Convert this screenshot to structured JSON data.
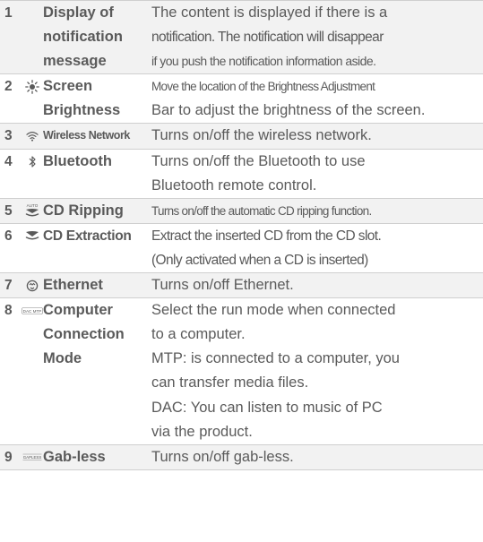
{
  "rows": [
    {
      "num": "1",
      "icon": "none",
      "name": [
        "Display of",
        "notification",
        "message"
      ],
      "desc": [
        "The content is displayed if there is a",
        "notification. The notification will disappear",
        "if you push the notification information aside."
      ]
    },
    {
      "num": "2",
      "icon": "sun-icon",
      "name": [
        "Screen",
        "Brightness"
      ],
      "desc": [
        "Move the location of the Brightness Adjustment",
        "Bar to adjust the brightness of the screen."
      ]
    },
    {
      "num": "3",
      "icon": "wifi-icon",
      "name": [
        "Wireless Network"
      ],
      "desc": [
        "Turns on/off the wireless network."
      ]
    },
    {
      "num": "4",
      "icon": "bluetooth-icon",
      "name": [
        "Bluetooth"
      ],
      "desc": [
        "Turns on/off the Bluetooth to use",
        "Bluetooth remote control."
      ]
    },
    {
      "num": "5",
      "icon": "cd-ripping-icon",
      "icon_label": "AUTO",
      "name": [
        "CD Ripping"
      ],
      "desc": [
        "Turns on/off the automatic CD ripping function."
      ]
    },
    {
      "num": "6",
      "icon": "cd-eject-icon",
      "name": [
        "CD Extraction"
      ],
      "desc": [
        "Extract the inserted CD from the CD slot.",
        "(Only activated when a CD is inserted)"
      ]
    },
    {
      "num": "7",
      "icon": "ethernet-icon",
      "name": [
        "Ethernet"
      ],
      "desc": [
        "Turns on/off Ethernet."
      ]
    },
    {
      "num": "8",
      "icon": "dac-mtp-icon",
      "icon_label": "DAC MTP",
      "name": [
        "Computer",
        "Connection",
        "Mode"
      ],
      "desc": [
        "Select the run mode when connected",
        "to a computer.",
        "MTP: is connected to a computer, you",
        "can transfer media files.",
        "DAC: You can listen to music of PC",
        "via the product."
      ]
    },
    {
      "num": "9",
      "icon": "gapless-icon",
      "icon_label": "GAPLESS",
      "name": [
        "Gab-less"
      ],
      "desc": [
        "Turns on/off gab-less."
      ]
    }
  ]
}
